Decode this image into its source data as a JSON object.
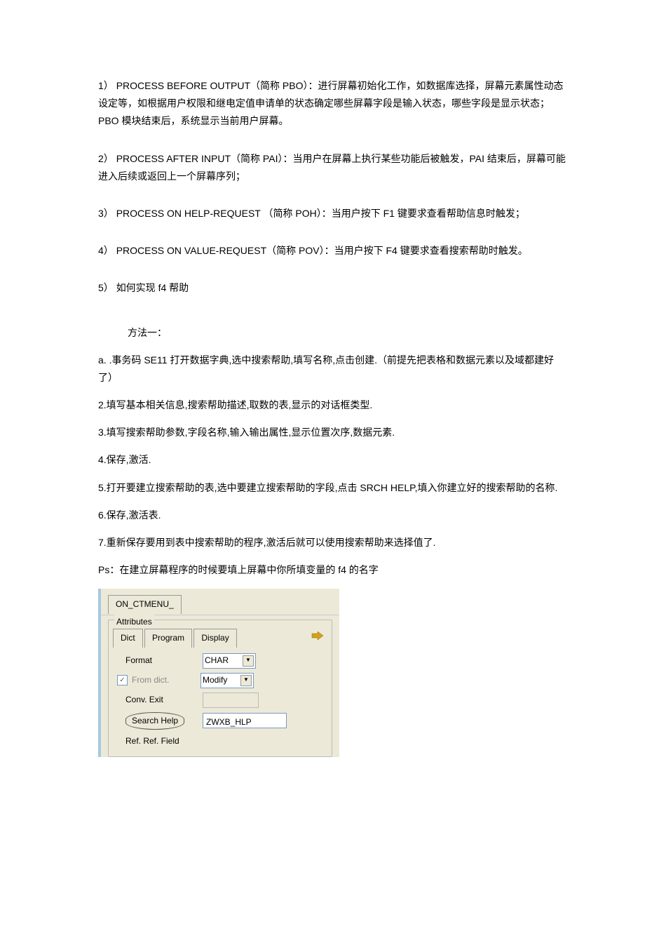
{
  "items": {
    "i1": {
      "num": "1）",
      "label": "PROCESS BEFORE OUTPUT（简称 PBO）：",
      "text": "进行屏幕初始化工作，如数据库选择，屏幕元素属性动态设定等，如根据用户权限和继电定值申请单的状态确定哪些屏幕字段是输入状态，哪些字段是显示状态；PBO 模块结束后，系统显示当前用户屏幕。"
    },
    "i2": {
      "num": "2）",
      "label": "PROCESS AFTER INPUT（简称 PAI）：",
      "text": "当用户在屏幕上执行某些功能后被触发，PAI 结束后，屏幕可能进入后续或返回上一个屏幕序列；"
    },
    "i3": {
      "num": "3）",
      "label": "PROCESS ON HELP-REQUEST （简称 POH）：",
      "text": "当用户按下 F1 键要求查看帮助信息时触发；"
    },
    "i4": {
      "num": "4）",
      "label": "PROCESS ON VALUE-REQUEST（简称 POV）：",
      "text": "当用户按下 F4 键要求查看搜索帮助时触发。"
    },
    "i5": {
      "num": "5）",
      "text": "如何实现 f4 帮助"
    }
  },
  "method": {
    "title": "方法一：",
    "a": "a. .事务码 SE11 打开数据字典,选中搜索帮助,填写名称,点击创建.（前提先把表格和数据元素以及域都建好了）",
    "s2": "2.填写基本相关信息,搜索帮助描述,取数的表,显示的对话框类型.",
    "s3": "3.填写搜索帮助参数,字段名称,输入输出属性,显示位置次序,数据元素.",
    "s4": "4.保存,激活.",
    "s5": "5.打开要建立搜索帮助的表,选中要建立搜索帮助的字段,点击 SRCH HELP,填入你建立好的搜索帮助的名称.",
    "s6": "6.保存,激活表.",
    "s7": "7.重新保存要用到表中搜索帮助的程序,激活后就可以使用搜索帮助来选择值了.",
    "ps": "Ps：在建立屏幕程序的时候要填上屏幕中你所填变量的 f4 的名字"
  },
  "ui": {
    "topTab": "ON_CTMENU_",
    "panelTitle": "Attributes",
    "subtabs": {
      "dict": "Dict",
      "program": "Program",
      "display": "Display"
    },
    "rows": {
      "format": "Format",
      "formatValue": "CHAR",
      "fromDict": "From dict.",
      "modify": "Modify",
      "convExit": "Conv. Exit",
      "searchHelp": "Search Help",
      "searchHelpValue": "ZWXB_HLP",
      "refField": "Ref. Field"
    }
  }
}
